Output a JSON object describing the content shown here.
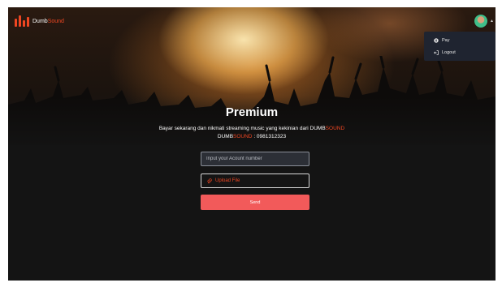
{
  "navbar": {
    "brand_prefix": "Dumb",
    "brand_accent": "Sound",
    "logo_icon": "bars-logo-icon",
    "avatar_icon": "user-avatar",
    "caret_icon": "caret-up-icon"
  },
  "dropdown": {
    "items": [
      {
        "label": "Pay",
        "icon": "pay-icon"
      },
      {
        "label": "Logout",
        "icon": "logout-icon"
      }
    ]
  },
  "content": {
    "title": "Premium",
    "desc_prefix": "Bayar sekarang dan nikmati streaming music yang kekinian dari DUMB",
    "desc_accent": "SOUND",
    "account_prefix": "DUMB",
    "account_accent": "SOUND",
    "account_number": " : 0981312323"
  },
  "form": {
    "account_placeholder": "Input your Acount number",
    "upload_label": "Upload File",
    "upload_icon": "paperclip-icon",
    "send_label": "Send"
  },
  "colors": {
    "accent": "#ee4622",
    "button": "#f25a5a",
    "background": "#141414",
    "dropdown_bg": "#1f2430"
  }
}
